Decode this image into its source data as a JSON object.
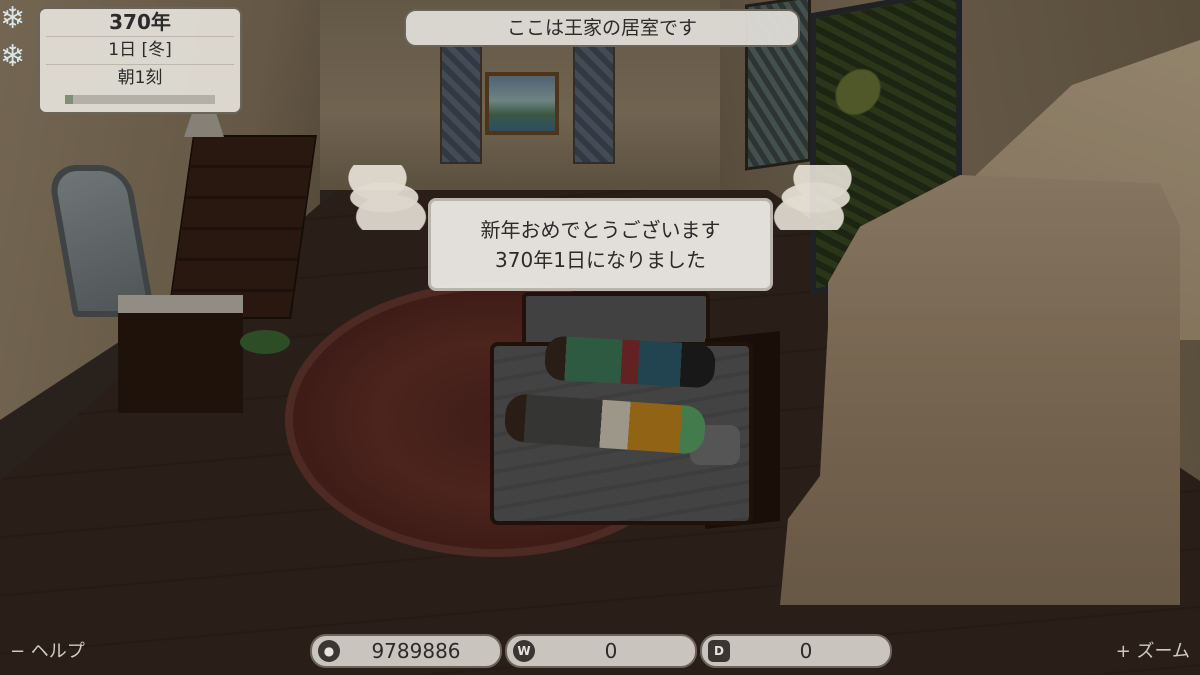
{
  "hud": {
    "year": "370年",
    "day": "1日 [冬]",
    "time_of_day": "朝1刻",
    "time_progress": 0.05,
    "season_icon": "snowflake-icon"
  },
  "location": {
    "text": "ここは王家の居室です"
  },
  "message": {
    "line1": "新年おめでとうございます",
    "line2": "370年1日になりました"
  },
  "bottom_bar": {
    "help_label": "− ヘルプ",
    "zoom_label": "+ ズーム",
    "gold": {
      "icon": "coin-icon",
      "value": "9789886"
    },
    "w_points": {
      "icon": "w-coin-icon",
      "icon_glyph": "W",
      "value": "0"
    },
    "d_points": {
      "icon": "d-badge-icon",
      "icon_glyph": "D",
      "value": "0"
    }
  }
}
